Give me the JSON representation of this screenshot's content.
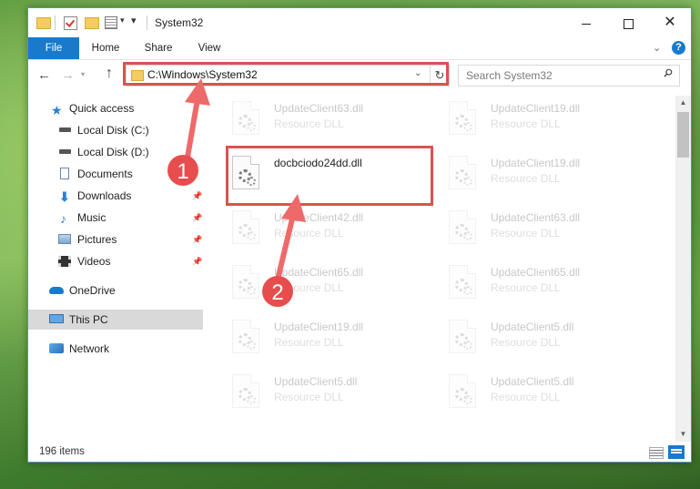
{
  "window": {
    "title": "System32",
    "minimize_label": "",
    "close_label": "✕"
  },
  "ribbon": {
    "tabs": [
      {
        "label": "File"
      },
      {
        "label": "Home"
      },
      {
        "label": "Share"
      },
      {
        "label": "View"
      }
    ],
    "help_label": "?"
  },
  "nav": {
    "back": "←",
    "forward": "→",
    "up": "↑",
    "refresh": "↻"
  },
  "address": {
    "path": "C:\\Windows\\System32"
  },
  "search": {
    "placeholder": "Search System32"
  },
  "sidebar": {
    "items": [
      {
        "label": "Quick access",
        "icon": "star-icon"
      },
      {
        "label": "Local Disk (C:)",
        "icon": "drive-icon"
      },
      {
        "label": "Local Disk (D:)",
        "icon": "drive-icon"
      },
      {
        "label": "Documents",
        "icon": "documents-icon"
      },
      {
        "label": "Downloads",
        "icon": "downloads-icon"
      },
      {
        "label": "Music",
        "icon": "music-icon"
      },
      {
        "label": "Pictures",
        "icon": "pictures-icon"
      },
      {
        "label": "Videos",
        "icon": "videos-icon"
      },
      {
        "label": "OneDrive",
        "icon": "cloud-icon"
      },
      {
        "label": "This PC",
        "icon": "computer-icon"
      },
      {
        "label": "Network",
        "icon": "network-icon"
      }
    ]
  },
  "files": [
    {
      "name": "UpdateClient63.dll",
      "type": "Resource DLL"
    },
    {
      "name": "UpdateClient19.dll",
      "type": "Resource DLL"
    },
    {
      "name": "docbciodo24dd.dll",
      "type": ""
    },
    {
      "name": "UpdateClient19.dll",
      "type": "Resource DLL"
    },
    {
      "name": "UpdateClient42.dll",
      "type": "Resource DLL"
    },
    {
      "name": "UpdateClient63.dll",
      "type": "Resource DLL"
    },
    {
      "name": "UpdateClient65.dll",
      "type": "Resource DLL"
    },
    {
      "name": "UpdateClient65.dll",
      "type": "Resource DLL"
    },
    {
      "name": "UpdateClient19.dll",
      "type": "Resource DLL"
    },
    {
      "name": "UpdateClient5.dll",
      "type": "Resource DLL"
    },
    {
      "name": "UpdateClient5.dll",
      "type": "Resource DLL"
    },
    {
      "name": "UpdateClient5.dll",
      "type": "Resource DLL"
    }
  ],
  "status": {
    "item_count": "196 items"
  },
  "annotations": {
    "step1": "1",
    "step2": "2",
    "color": "#d9534f"
  }
}
